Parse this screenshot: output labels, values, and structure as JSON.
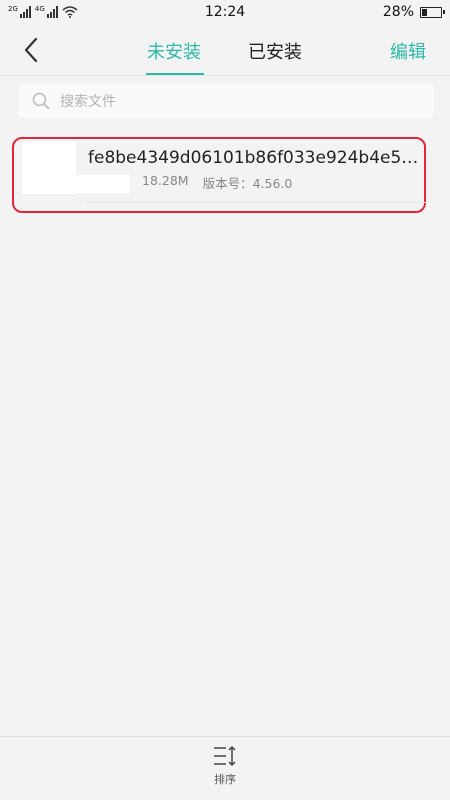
{
  "status_bar": {
    "signal1_label": "2G",
    "signal2_label": "4G",
    "time": "12:24",
    "battery_percent": "28%",
    "battery_level": 0.28
  },
  "header": {
    "tabs": [
      {
        "label": "未安装",
        "active": true
      },
      {
        "label": "已安装",
        "active": false
      }
    ],
    "edit_label": "编辑",
    "accent_color": "#2eb8a6"
  },
  "search": {
    "placeholder": "搜索文件"
  },
  "files": [
    {
      "name": "fe8be4349d06101b86f033e924b4e5a...",
      "size": "18.28M",
      "version": "版本号：4.56.0"
    }
  ],
  "bottom_bar": {
    "sort_label": "排序"
  },
  "icons": {
    "back": "chevron-left-icon",
    "search": "search-icon",
    "sort": "sort-icon",
    "wifi": "wifi-icon",
    "battery": "battery-icon"
  }
}
